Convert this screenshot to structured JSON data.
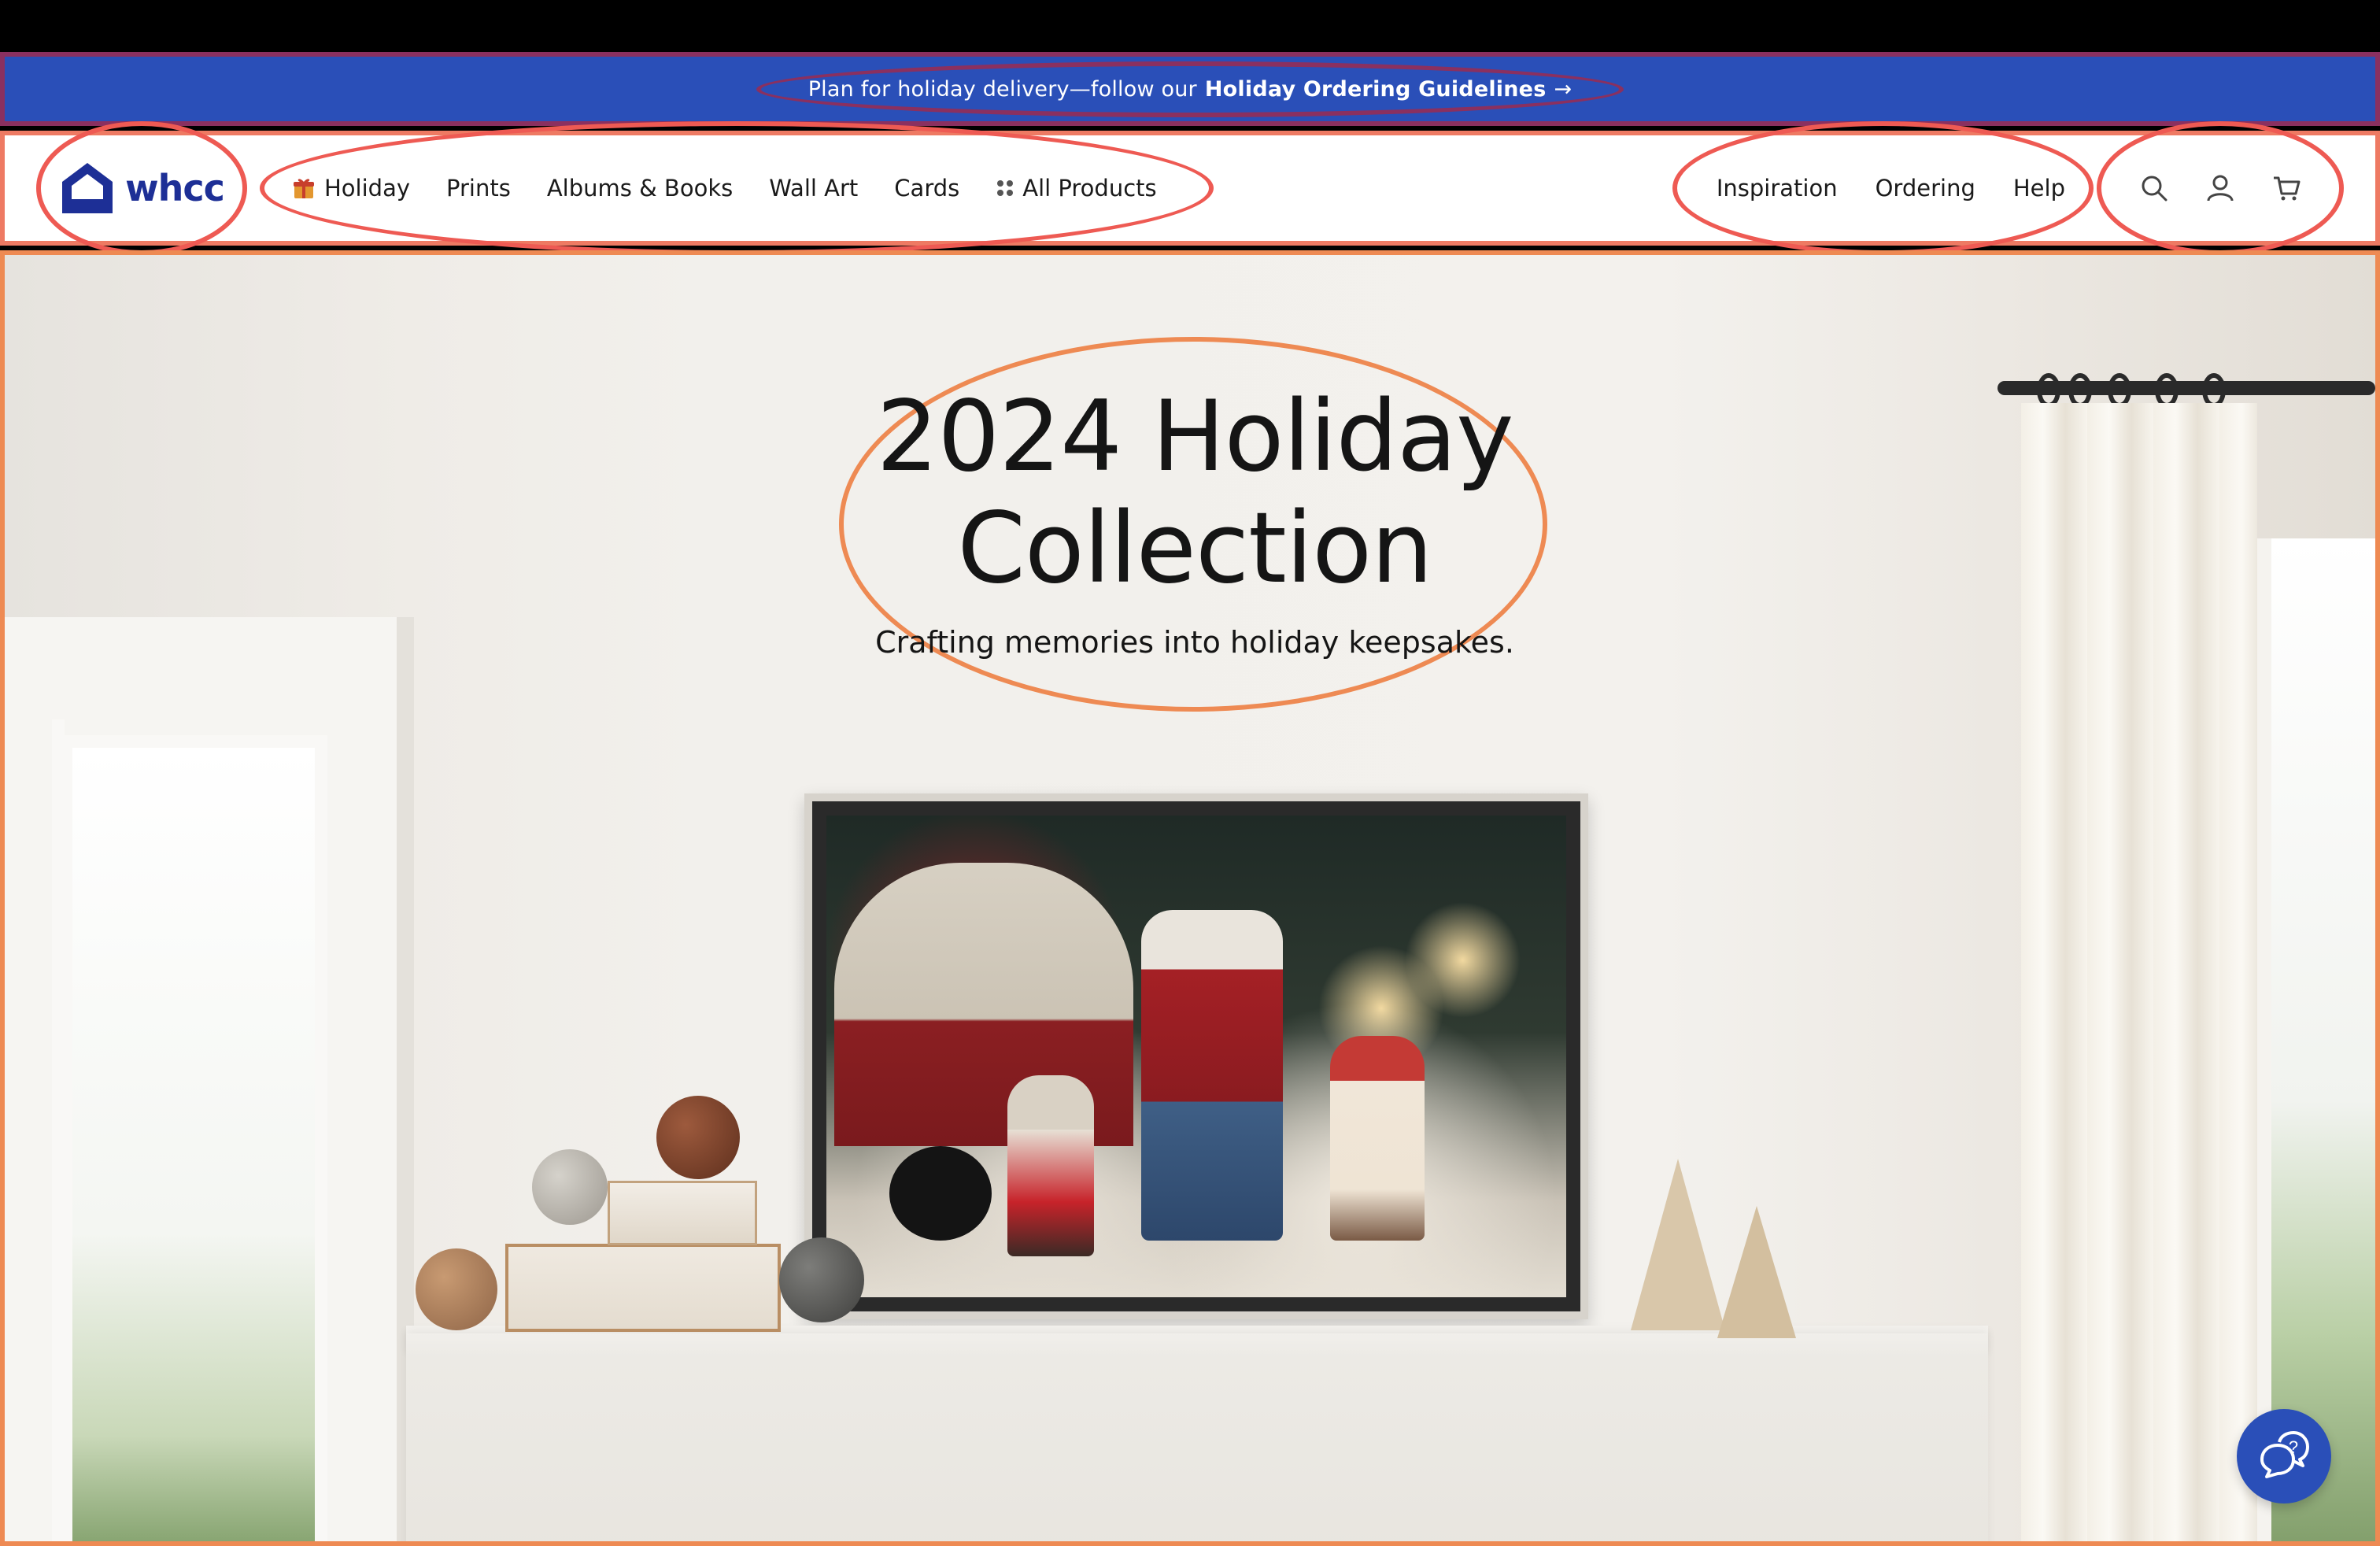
{
  "promo": {
    "text_prefix": "Plan for holiday delivery—follow our",
    "text_link": "Holiday Ordering Guidelines",
    "arrow": "→"
  },
  "header": {
    "logo_text": "whcc",
    "nav_left": [
      {
        "label": "Holiday",
        "icon": "gift-icon"
      },
      {
        "label": "Prints"
      },
      {
        "label": "Albums & Books"
      },
      {
        "label": "Wall Art"
      },
      {
        "label": "Cards"
      },
      {
        "label": "All Products",
        "icon": "grid-dots-icon"
      }
    ],
    "nav_right": [
      {
        "label": "Inspiration"
      },
      {
        "label": "Ordering"
      },
      {
        "label": "Help"
      }
    ],
    "icons": [
      "search-icon",
      "account-icon",
      "cart-icon"
    ]
  },
  "hero": {
    "title_line1": "2024 Holiday",
    "title_line2": "Collection",
    "subtitle": "Crafting memories into holiday keepsakes."
  },
  "colors": {
    "brand_blue": "#2a4fb8",
    "logo_navy": "#1d2f96"
  }
}
